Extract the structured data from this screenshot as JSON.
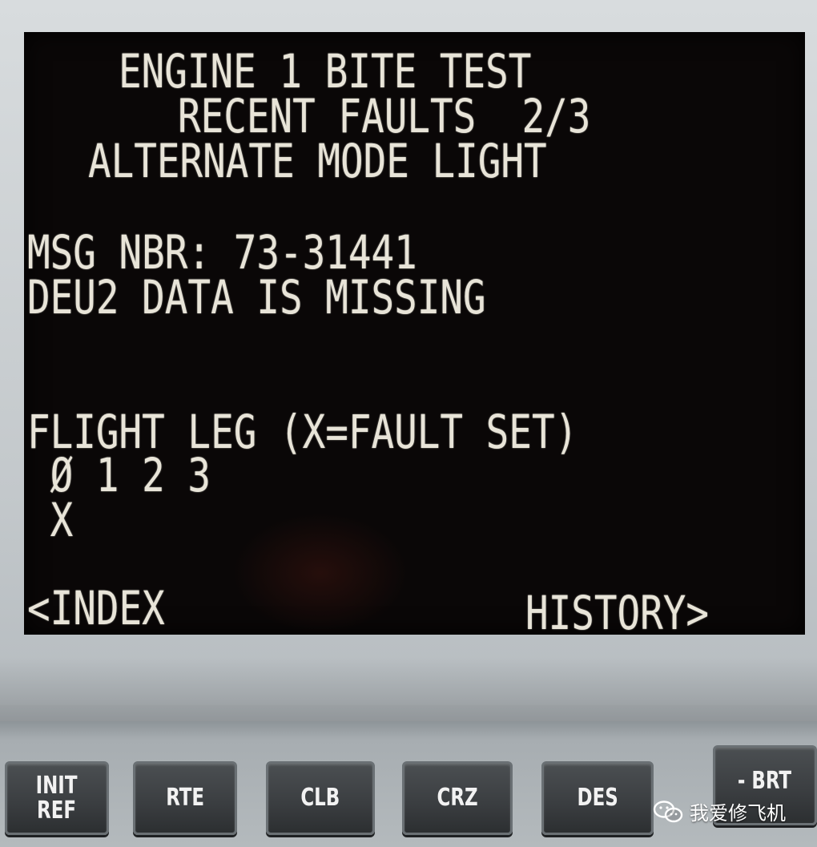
{
  "screen": {
    "title_line1": "ENGINE 1 BITE TEST",
    "title_line2": "RECENT FAULTS  2/3",
    "title_line3": "ALTERNATE MODE LIGHT",
    "msg_line": "MSG NBR: 73-31441",
    "status_line": "DEU2 DATA IS MISSING",
    "flight_leg_header": "FLIGHT LEG (X=FAULT SET)",
    "flight_leg_numbers": " Ø 1 2 3",
    "flight_leg_marks": " X",
    "left_lsk": "<INDEX",
    "right_lsk": "HISTORY>"
  },
  "keys": [
    {
      "label": "INIT\nREF"
    },
    {
      "label": "RTE"
    },
    {
      "label": "CLB"
    },
    {
      "label": "CRZ"
    },
    {
      "label": "DES"
    },
    {
      "label": "- BRT"
    }
  ],
  "watermark": {
    "text": "我爱修飞机",
    "icon": "wechat-icon"
  },
  "colors": {
    "screen_bg": "#0a0707",
    "screen_text": "#e8e4d8",
    "key_face": "#3a3d40",
    "bezel": "#c3c8cb"
  }
}
